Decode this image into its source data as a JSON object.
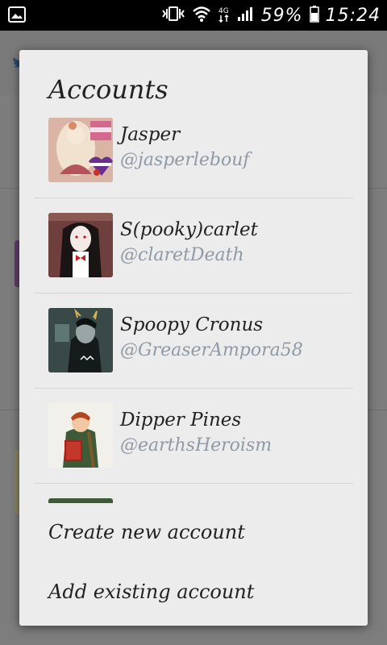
{
  "status_bar": {
    "battery_percent": "59%",
    "time": "15:24",
    "icons": [
      "gallery-notification-icon",
      "vibrate-icon",
      "wifi-icon",
      "4g-icon",
      "signal-icon",
      "battery-icon"
    ]
  },
  "dialog": {
    "title": "Accounts",
    "accounts": [
      {
        "name": "Jasper",
        "handle": "@jasperlebouf"
      },
      {
        "name": "S(pooky)carlet",
        "handle": "@claretDeath"
      },
      {
        "name": "Spoopy Cronus",
        "handle": "@GreaserAmpora58"
      },
      {
        "name": "Dipper Pines",
        "handle": "@earthsHeroism"
      }
    ],
    "actions": {
      "create": "Create new account",
      "add_existing": "Add existing account"
    }
  },
  "colors": {
    "dialog_bg": "#ececec",
    "handle_text": "#8f9aa6",
    "title_text": "#222222",
    "scrim": "#7a7a7a"
  }
}
